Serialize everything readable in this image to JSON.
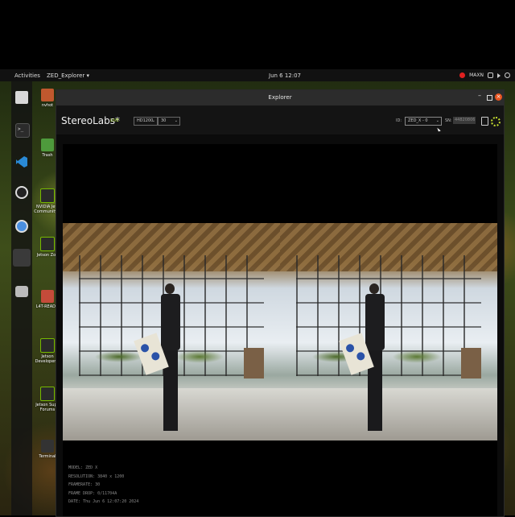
{
  "topbar": {
    "activities": "Activities",
    "app_menu": "ZED_Explorer ▾",
    "clock": "Jun 6 12:07",
    "power_mode": "MAXN"
  },
  "dock": [
    "files",
    "terminal",
    "vscode",
    "obs",
    "chromium",
    "active-app",
    "drive"
  ],
  "desktop_icons": [
    {
      "label": "nvhot",
      "icon": "home-folder-icon"
    },
    {
      "label": "Trash",
      "icon": "trash-icon"
    },
    {
      "label": "NVIDIA Jets Community F",
      "icon": "nvidia-icon"
    },
    {
      "label": "Jetson Zoo",
      "icon": "nvidia-icon"
    },
    {
      "label": "L4T-READM",
      "icon": "document-icon"
    },
    {
      "label": "Jetson Developer Z",
      "icon": "nvidia-icon"
    },
    {
      "label": "Jetson Supp Forums",
      "icon": "nvidia-icon"
    },
    {
      "label": "Terminal",
      "icon": "terminal-icon"
    }
  ],
  "window": {
    "title": "Explorer"
  },
  "toolbar": {
    "brand": "StereoLabs*",
    "live": "LIVE",
    "resolution": "HD1200",
    "fps": "30",
    "id_label": "ID:",
    "camera": "ZED_X - 0",
    "sn_label": "SN:",
    "serial": "44820806"
  },
  "info": {
    "model": "MODEL: ZED X",
    "resolution": "RESOLUTION: 3840 x 1200",
    "framerate": "FRAMERATE: 30",
    "frame_drop": "FRAME DROP: 0/11704A",
    "date": "DATE: Thu Jun 6 12:07:20 2024"
  },
  "colors": {
    "accent_green": "#9ccc2a",
    "close_orange": "#e95420"
  }
}
